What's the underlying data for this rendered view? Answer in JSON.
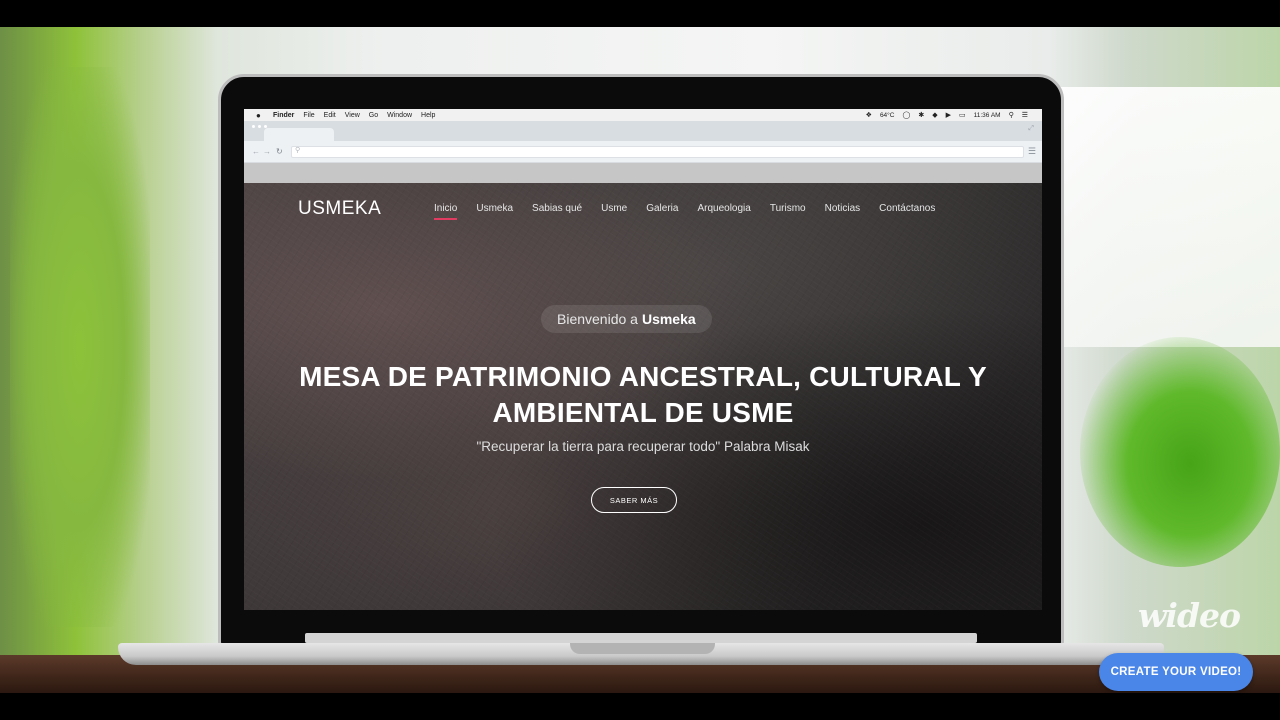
{
  "menubar": {
    "apple_icon": "apple-logo-icon",
    "items": [
      "Finder",
      "File",
      "Edit",
      "View",
      "Go",
      "Window",
      "Help"
    ],
    "temperature": "64°C",
    "time": "11:36 AM"
  },
  "browser": {
    "omnibox_placeholder": "",
    "icons": [
      "back-icon",
      "forward-icon",
      "reload-icon",
      "search-icon",
      "menu-icon",
      "expand-icon"
    ]
  },
  "site": {
    "logo": "USMEKA",
    "nav": [
      "Inicio",
      "Usmeka",
      "Sabias qué",
      "Usme",
      "Galeria",
      "Arqueologia",
      "Turismo",
      "Noticias",
      "Contáctanos"
    ],
    "welcome_prefix": "Bienvenido a",
    "welcome_brand": "Usmeka",
    "headline_line1": "MESA DE PATRIMONIO ANCESTRAL, CULTURAL Y",
    "headline_line2": "AMBIENTAL DE USME",
    "quote": "\"Recuperar la tierra para recuperar todo\" Palabra Misak",
    "cta": "SABER MÁS",
    "accent_color": "#e23b62"
  },
  "watermark": {
    "brand": "wideo",
    "button": "CREATE YOUR VIDEO!",
    "button_color": "#4a86e8"
  }
}
